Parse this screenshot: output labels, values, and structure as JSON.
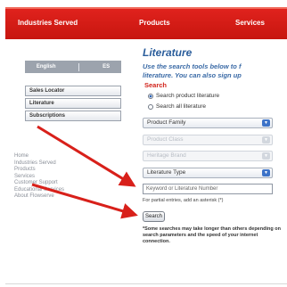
{
  "nav": {
    "items": [
      "Industries Served",
      "Products",
      "Services"
    ]
  },
  "sidebar": {
    "languages": [
      "English",
      "ES"
    ],
    "buttons": [
      "Sales Locator",
      "Literature",
      "Subscriptions"
    ],
    "links": [
      "Home",
      "Industries Served",
      "Products",
      "Services",
      "Customer Support",
      "Educational Services",
      "About Flowserve"
    ]
  },
  "main": {
    "title": "Literature",
    "intro_line1": "Use the search tools below to f",
    "intro_line2": "literature. You can also sign up",
    "search_heading": "Search",
    "radio_product": "Search product literature",
    "radio_all": "Search all literature",
    "selects": [
      "Product Family",
      "Product Class",
      "Heritage Brand",
      "Literature Type"
    ],
    "keyword_placeholder": "Keyword or Literature Number",
    "partial_hint": "For partial entries, add an asterisk (*)",
    "search_button": "Search",
    "note": "*Some searches may take longer than others depending on search parameters and the speed of your internet connection."
  },
  "colors": {
    "nav_red": "#d11b15",
    "title_blue": "#2a5d9b",
    "annotation_red": "#d8201a"
  }
}
